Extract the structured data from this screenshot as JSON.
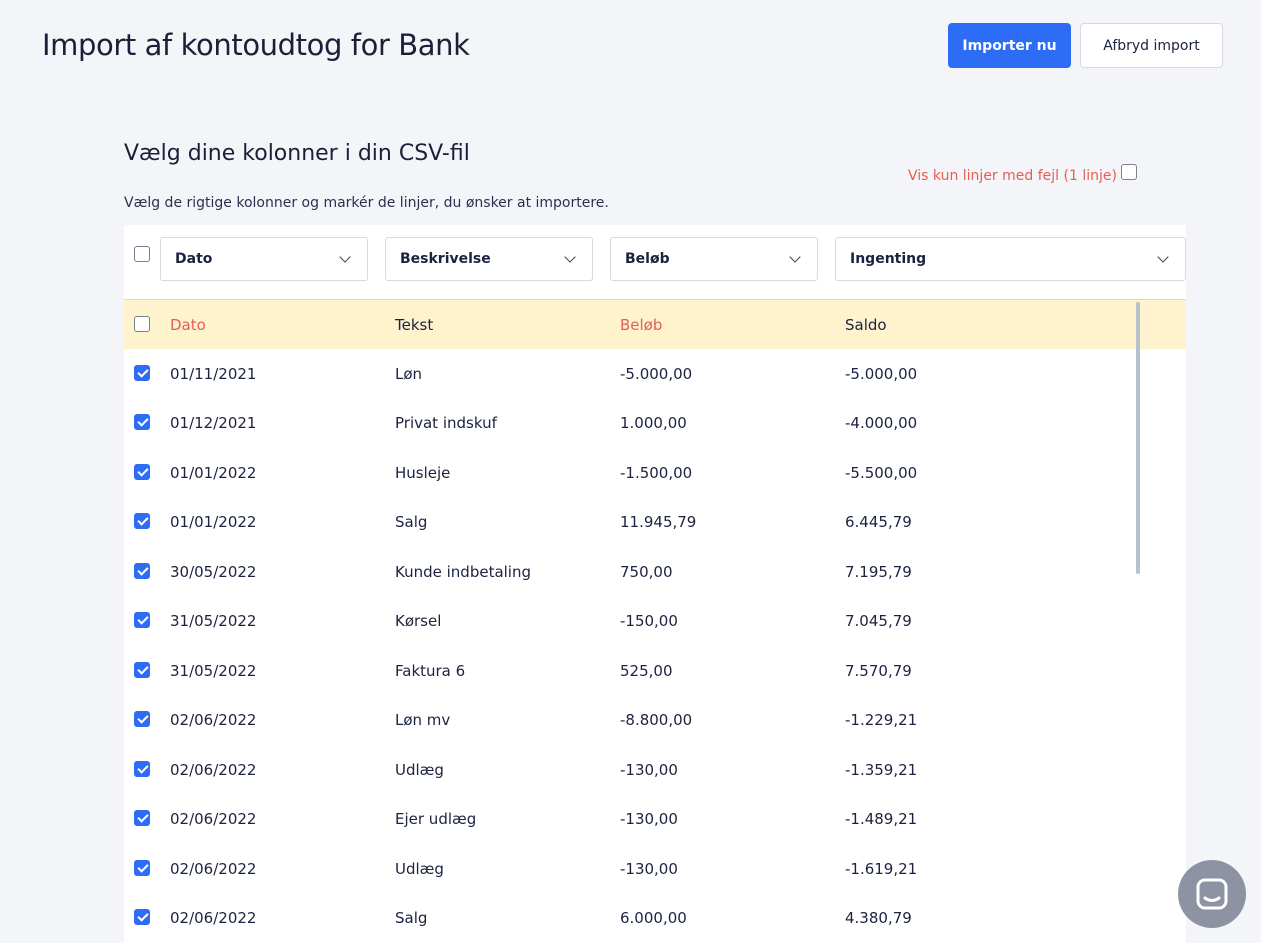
{
  "header": {
    "title": "Import af kontoudtog for Bank",
    "import_label": "Importer nu",
    "cancel_label": "Afbryd import"
  },
  "section": {
    "title": "Vælg dine kolonner i din CSV-fil",
    "subtitle": "Vælg de rigtige kolonner og markér de linjer, du ønsker at importere.",
    "filter_label": "Vis kun linjer med fejl (1 linje)"
  },
  "column_selects": [
    {
      "value": "Dato"
    },
    {
      "value": "Beskrivelse"
    },
    {
      "value": "Beløb"
    },
    {
      "value": "Ingenting"
    }
  ],
  "table": {
    "header": {
      "c1": "Dato",
      "c2": "Tekst",
      "c3": "Beløb",
      "c4": "Saldo"
    },
    "rows": [
      {
        "date": "01/11/2021",
        "text": "Løn",
        "amount": "-5.000,00",
        "balance": "-5.000,00"
      },
      {
        "date": "01/12/2021",
        "text": "Privat indskuf",
        "amount": "1.000,00",
        "balance": "-4.000,00"
      },
      {
        "date": "01/01/2022",
        "text": "Husleje",
        "amount": "-1.500,00",
        "balance": "-5.500,00"
      },
      {
        "date": "01/01/2022",
        "text": "Salg",
        "amount": "11.945,79",
        "balance": "6.445,79"
      },
      {
        "date": "30/05/2022",
        "text": "Kunde indbetaling",
        "amount": "750,00",
        "balance": "7.195,79"
      },
      {
        "date": "31/05/2022",
        "text": "Kørsel",
        "amount": "-150,00",
        "balance": "7.045,79"
      },
      {
        "date": "31/05/2022",
        "text": "Faktura 6",
        "amount": "525,00",
        "balance": "7.570,79"
      },
      {
        "date": "02/06/2022",
        "text": "Løn mv",
        "amount": "-8.800,00",
        "balance": "-1.229,21"
      },
      {
        "date": "02/06/2022",
        "text": "Udlæg",
        "amount": "-130,00",
        "balance": "-1.359,21"
      },
      {
        "date": "02/06/2022",
        "text": "Ejer udlæg",
        "amount": "-130,00",
        "balance": "-1.489,21"
      },
      {
        "date": "02/06/2022",
        "text": "Udlæg",
        "amount": "-130,00",
        "balance": "-1.619,21"
      },
      {
        "date": "02/06/2022",
        "text": "Salg",
        "amount": "6.000,00",
        "balance": "4.380,79"
      }
    ]
  },
  "colors": {
    "accent": "#2d6df6",
    "error": "#e45f52",
    "header_row": "#fef3cd"
  },
  "icons": {
    "chat": "chat-bubble-icon",
    "chevron": "chevron-down-icon",
    "checkbox": "checkbox-icon"
  }
}
